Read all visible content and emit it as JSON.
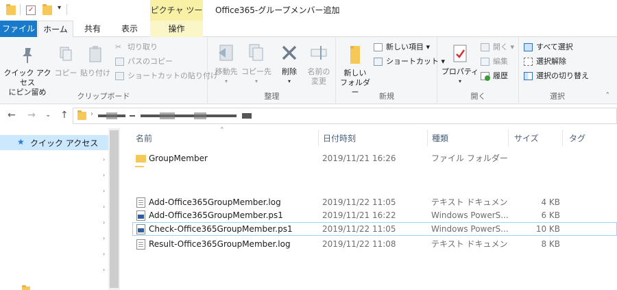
{
  "title_bar": {
    "contextual_tab_header": "ピクチャ ツール",
    "window_title": "Office365-グループメンバー追加"
  },
  "tabs": {
    "file": "ファイル",
    "home": "ホーム",
    "share": "共有",
    "view": "表示",
    "manage": "操作"
  },
  "ribbon": {
    "clipboard": {
      "label": "クリップボード",
      "pin_quick_access": "クイック アクセス\nにピン留め",
      "copy": "コピー",
      "paste": "貼り付け",
      "cut": "切り取り",
      "copy_path": "パスのコピー",
      "paste_shortcut": "ショートカットの貼り付け"
    },
    "organize": {
      "label": "整理",
      "move_to": "移動先",
      "copy_to": "コピー先",
      "delete": "削除",
      "rename": "名前の\n変更"
    },
    "new": {
      "label": "新規",
      "new_folder": "新しい\nフォルダー",
      "new_item": "新しい項目 ▾",
      "shortcut": "ショートカット ▾"
    },
    "open": {
      "label": "開く",
      "properties": "プロパティ",
      "open": "開く ▾",
      "edit": "編集",
      "history": "履歴"
    },
    "select": {
      "label": "選択",
      "select_all": "すべて選択",
      "select_none": "選択解除",
      "invert_selection": "選択の切り替え"
    }
  },
  "navigation": {
    "back": "←",
    "forward": "→",
    "recent": "⌄",
    "up": "↑"
  },
  "nav_pane": {
    "quick_access": "クイック アクセス"
  },
  "columns": {
    "name": "名前",
    "date": "日付時刻",
    "type": "種類",
    "size": "サイズ",
    "tags": "タグ"
  },
  "files": [
    {
      "name": "GroupMember",
      "date": "2019/11/21 16:26",
      "type": "ファイル フォルダー",
      "size": "",
      "icon": "folder-icon"
    },
    {
      "name": "Add-Office365GroupMember.log",
      "date": "2019/11/22 11:05",
      "type": "テキスト ドキュメント",
      "size": "4 KB",
      "icon": "text-file-icon"
    },
    {
      "name": "Add-Office365GroupMember.ps1",
      "date": "2019/11/21 16:22",
      "type": "Windows PowerS...",
      "size": "6 KB",
      "icon": "powershell-file-icon"
    },
    {
      "name": "Check-Office365GroupMember.ps1",
      "date": "2019/11/22 11:05",
      "type": "Windows PowerS...",
      "size": "10 KB",
      "icon": "powershell-file-icon"
    },
    {
      "name": "Result-Office365GroupMember.log",
      "date": "2019/11/22 11:08",
      "type": "テキスト ドキュメント",
      "size": "8 KB",
      "icon": "text-file-icon"
    }
  ],
  "colors": {
    "file_tab": "#1979ca",
    "contextual_header": "#f8f1a5",
    "selection": "#cce8ff",
    "selected_border": "#99d1ff"
  }
}
